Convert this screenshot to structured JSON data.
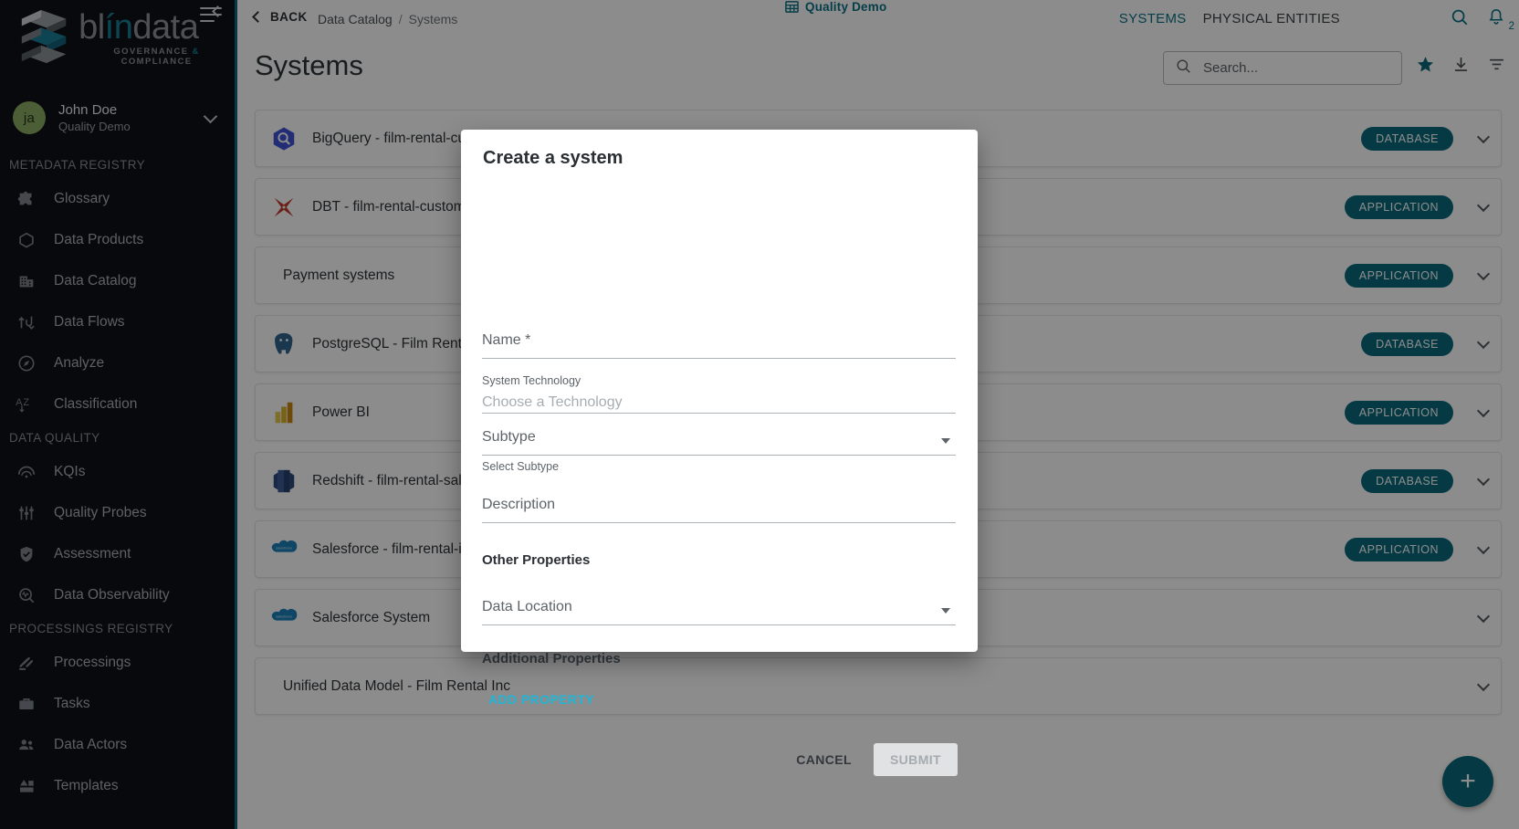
{
  "sidebar": {
    "brand": {
      "word_1": "bl",
      "word_2": "ín",
      "word_3": "data",
      "tagline_1": "GOVERNANCE",
      "tagline_amp": "&",
      "tagline_2": "COMPLIANCE"
    },
    "user": {
      "initials": "ja",
      "name": "John Doe",
      "org": "Quality Demo"
    },
    "sections": [
      {
        "label": "METADATA REGISTRY",
        "items": [
          {
            "label": "Glossary",
            "icon": "puzzle-icon"
          },
          {
            "label": "Data Products",
            "icon": "hexagon-icon"
          },
          {
            "label": "Data Catalog",
            "icon": "building-icon"
          },
          {
            "label": "Data Flows",
            "icon": "data-flow-icon"
          },
          {
            "label": "Analyze",
            "icon": "compass-icon"
          },
          {
            "label": "Classification",
            "icon": "az-sort-icon"
          }
        ]
      },
      {
        "label": "DATA QUALITY",
        "items": [
          {
            "label": "KQIs",
            "icon": "speedometer-icon"
          },
          {
            "label": "Quality Probes",
            "icon": "sliders-icon"
          },
          {
            "label": "Assessment",
            "icon": "shield-check-icon"
          },
          {
            "label": "Data Observability",
            "icon": "search-pulse-icon"
          }
        ]
      },
      {
        "label": "PROCESSINGS REGISTRY",
        "items": [
          {
            "label": "Processings",
            "icon": "gavel-icon"
          },
          {
            "label": "Tasks",
            "icon": "briefcase-icon"
          },
          {
            "label": "Data Actors",
            "icon": "people-icon"
          },
          {
            "label": "Templates",
            "icon": "templates-icon"
          }
        ]
      }
    ]
  },
  "topbar": {
    "back_label": "BACK",
    "breadcrumbs": [
      "Data Catalog",
      "Systems"
    ],
    "breadcrumb_separator": "/",
    "context_label": "Quality Demo",
    "tabs": [
      {
        "label": "SYSTEMS",
        "active": true
      },
      {
        "label": "PHYSICAL ENTITIES",
        "active": false
      }
    ],
    "icons": [
      "search-icon",
      "notifications-bell-icon"
    ],
    "notification_count": "2"
  },
  "page": {
    "title": "Systems",
    "search_placeholder": "Search...",
    "toolbar_icons": [
      "star-icon",
      "download-icon",
      "filter-icon"
    ],
    "fab_label": "+"
  },
  "rows": [
    {
      "title": "BigQuery - film-rental-customer",
      "badge": "DATABASE",
      "icon": "bigquery-icon"
    },
    {
      "title": "DBT - film-rental-customer",
      "badge": "APPLICATION",
      "icon": "dbt-icon"
    },
    {
      "title": "Payment systems",
      "badge": "APPLICATION",
      "icon": "none"
    },
    {
      "title": "PostgreSQL - Film Rental Inc",
      "badge": "DATABASE",
      "icon": "postgresql-icon"
    },
    {
      "title": "Power BI",
      "badge": "APPLICATION",
      "icon": "powerbi-icon"
    },
    {
      "title": "Redshift - film-rental-sales",
      "badge": "DATABASE",
      "icon": "redshift-icon"
    },
    {
      "title": "Salesforce - film-rental-inc",
      "badge": "APPLICATION",
      "icon": "salesforce-icon"
    },
    {
      "title": "Salesforce System",
      "badge": "",
      "icon": "salesforce-icon"
    },
    {
      "title": "Unified Data Model - Film Rental Inc",
      "badge": "",
      "icon": "none"
    }
  ],
  "modal": {
    "title": "Create a system",
    "name_label": "Name *",
    "system_technology_label": "System Technology",
    "system_technology_placeholder": "Choose a Technology",
    "subtype_label": "Subtype",
    "subtype_helper": "Select Subtype",
    "description_label": "Description",
    "other_properties_heading": "Other Properties",
    "data_location_label": "Data Location",
    "additional_properties_heading": "Additional Properties",
    "add_property_label": "ADD PROPERTY",
    "cancel_label": "CANCEL",
    "submit_label": "SUBMIT"
  },
  "colors": {
    "accent": "#0a6b7c",
    "link": "#1fb6d8",
    "sidebar_bg": "#0d1117",
    "avatar": "#8aab63"
  }
}
